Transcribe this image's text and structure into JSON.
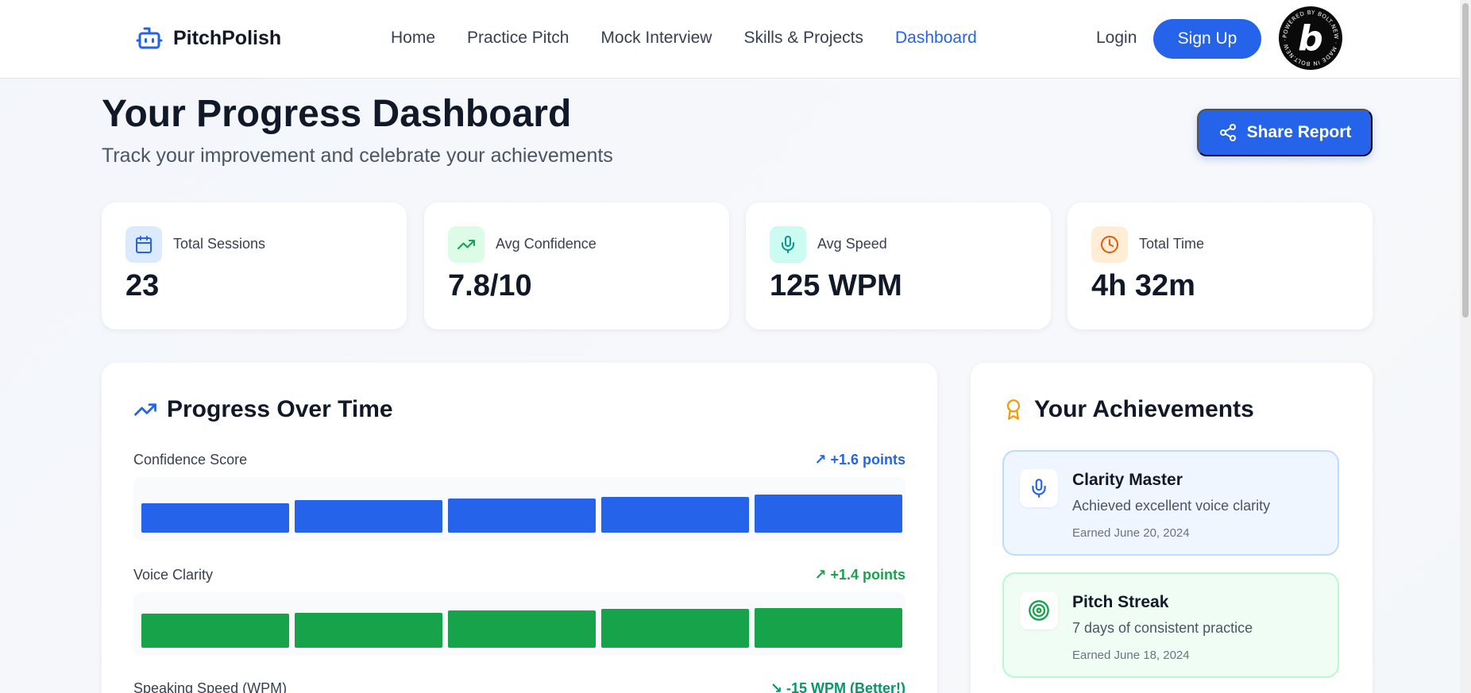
{
  "header": {
    "logo_text": "PitchPolish",
    "nav": [
      "Home",
      "Practice Pitch",
      "Mock Interview",
      "Skills & Projects",
      "Dashboard"
    ],
    "active_nav": "Dashboard",
    "login_label": "Login",
    "signup_label": "Sign Up",
    "badge_text": "POWERED BY BOLT.NEW · MADE IN BOLT.NEW ·",
    "badge_letter": "b"
  },
  "page": {
    "title": "Your Progress Dashboard",
    "subtitle": "Track your improvement and celebrate your achievements",
    "share_label": "Share Report"
  },
  "stats": [
    {
      "label": "Total Sessions",
      "value": "23",
      "icon": "calendar-icon"
    },
    {
      "label": "Avg Confidence",
      "value": "7.8/10",
      "icon": "trending-up-icon"
    },
    {
      "label": "Avg Speed",
      "value": "125 WPM",
      "icon": "microphone-icon"
    },
    {
      "label": "Total Time",
      "value": "4h 32m",
      "icon": "clock-icon"
    }
  ],
  "progress": {
    "title": "Progress Over Time",
    "metrics": [
      {
        "label": "Confidence Score",
        "delta": "↗ +1.6 points",
        "color": "#2563eb",
        "levels": [
          0.61,
          0.69,
          0.72,
          0.75,
          0.8
        ]
      },
      {
        "label": "Voice Clarity",
        "delta": "↗ +1.4 points",
        "color": "#16a34a",
        "levels": [
          0.72,
          0.74,
          0.78,
          0.81,
          0.84
        ]
      },
      {
        "label": "Speaking Speed (WPM)",
        "delta": "↘ -15 WPM (Better!)",
        "color": "#059669"
      }
    ]
  },
  "achievements": {
    "title": "Your Achievements",
    "items": [
      {
        "title": "Clarity Master",
        "desc": "Achieved excellent voice clarity",
        "date": "Earned June 20, 2024",
        "icon": "microphone-icon",
        "bg": "#eff6ff",
        "border": "#bfdbfe"
      },
      {
        "title": "Pitch Streak",
        "desc": "7 days of consistent practice",
        "date": "Earned June 18, 2024",
        "icon": "target-icon",
        "bg": "#f0fdf4",
        "border": "#bbf7d0"
      }
    ]
  }
}
